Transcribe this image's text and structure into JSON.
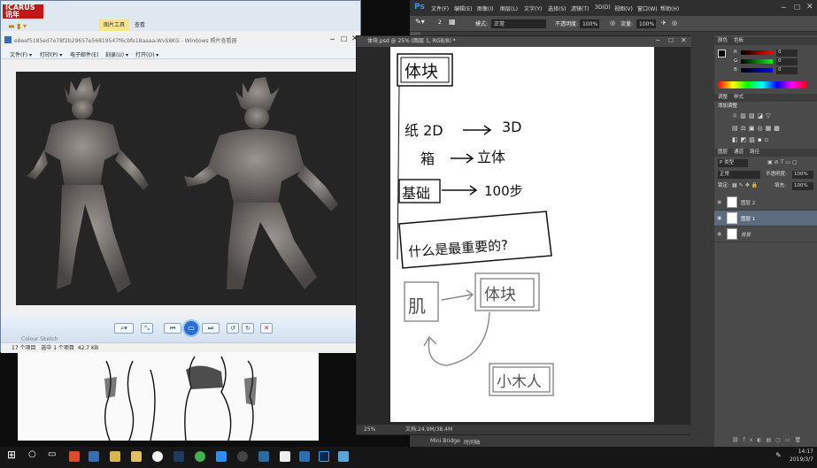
{
  "watermark": {
    "line1": "ICARUS",
    "line2": "讯年"
  },
  "explorer": {
    "ribbon_tabs": [
      "图片工具",
      "查看"
    ],
    "title": "e8eef5185ed7e78f2b29657e56819547f6cbfe18aaaa-WvS8KG - Windows 照片查看器",
    "menu": [
      "文件(F) ▾",
      "打印(P) ▾",
      "电子邮件(E)",
      "刻录(U) ▾",
      "打开(O) ▾"
    ],
    "status_left": "17 个项目",
    "status_sel": "选中 1 个项目",
    "status_size": "42.7 KB",
    "below_caption": "Colour Sketch"
  },
  "photoshop": {
    "logo": "Ps",
    "menu": [
      "文件(F)",
      "编辑(E)",
      "图像(I)",
      "图层(L)",
      "文字(Y)",
      "选择(S)",
      "滤镜(T)",
      "3D(D)",
      "视图(V)",
      "窗口(W)",
      "帮助(H)"
    ],
    "options": {
      "size": "2",
      "mode_label": "模式:",
      "mode_value": "正常",
      "opacity_label": "不透明度:",
      "opacity_value": "100%",
      "flow_label": "流量:",
      "flow_value": "100%"
    },
    "doc_tab": "体块.psd @ 25% (图层 1, RGB/8) *",
    "zoom": "25%",
    "doc_info": "文档:24.9M/38.4M",
    "mini_bridge": "Mini Bridge",
    "timeline": "时间轴",
    "panels": {
      "color_tabs": [
        "颜色",
        "色板"
      ],
      "color_rows": [
        {
          "label": "R",
          "value": "0"
        },
        {
          "label": "G",
          "value": "0"
        },
        {
          "label": "B",
          "value": "0"
        }
      ],
      "adjust_tabs": [
        "调整",
        "样式"
      ],
      "adjust_title": "添加调整",
      "layer_tabs": [
        "图层",
        "通道",
        "路径"
      ],
      "kind_label": "Ρ 类型",
      "blend_mode": "正常",
      "opacity_label": "不透明度:",
      "opacity_value": "100%",
      "lock_label": "锁定:",
      "fill_label": "填充:",
      "fill_value": "100%",
      "layers": [
        {
          "name": "图层 2",
          "selected": false
        },
        {
          "name": "图层 1",
          "selected": true
        },
        {
          "name": "背景",
          "selected": false
        }
      ]
    }
  },
  "notes": {
    "title": "体块",
    "line1_a": "纸 2D",
    "line1_b": "3D",
    "line2_a": "箱",
    "line2_b": "立体",
    "line3_a": "基础",
    "line3_b": "100步",
    "question": "什么是最重要的?",
    "muscle": "肌",
    "block": "体块",
    "wood": "小木人"
  },
  "taskbar": {
    "time": "14:17",
    "date": "2019/3/7"
  }
}
